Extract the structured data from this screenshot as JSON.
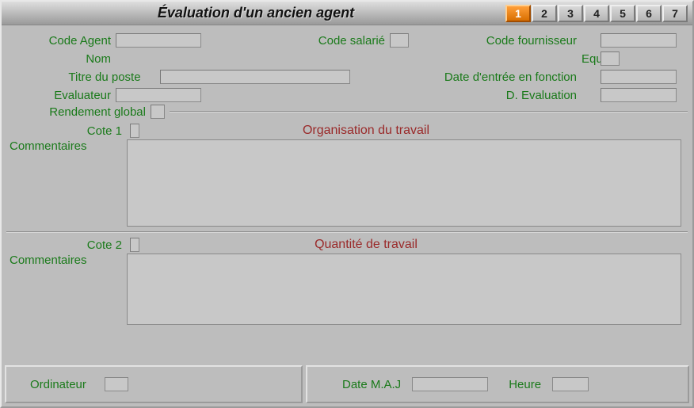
{
  "window": {
    "title": "Évaluation d'un ancien agent"
  },
  "tabs": [
    "1",
    "2",
    "3",
    "4",
    "5",
    "6",
    "7"
  ],
  "activeTab": 0,
  "labels": {
    "code_agent": "Code Agent",
    "code_salarie": "Code salarié",
    "code_fournisseur": "Code fournisseur",
    "nom": "Nom",
    "equipe": "Equipe",
    "titre_poste": "Titre du poste",
    "date_entree": "Date d'entrée en fonction",
    "evaluateur": "Evaluateur",
    "d_evaluation": "D. Evaluation",
    "rendement_global": "Rendement global",
    "cote1": "Cote 1",
    "cote2": "Cote 2",
    "commentaires": "Commentaires",
    "ordinateur": "Ordinateur",
    "date_maj": "Date M.A.J",
    "heure": "Heure"
  },
  "sections": {
    "s1": "Organisation du travail",
    "s2": "Quantité de travail"
  },
  "values": {
    "code_agent": "",
    "code_salarie": "",
    "code_fournisseur": "",
    "nom": "",
    "equipe": "",
    "titre_poste": "",
    "date_entree": "",
    "evaluateur": "",
    "d_evaluation": "",
    "rendement_global": "",
    "cote1": "",
    "cote2": "",
    "comment1": "",
    "comment2": "",
    "ordinateur": "",
    "date_maj": "",
    "heure": ""
  }
}
